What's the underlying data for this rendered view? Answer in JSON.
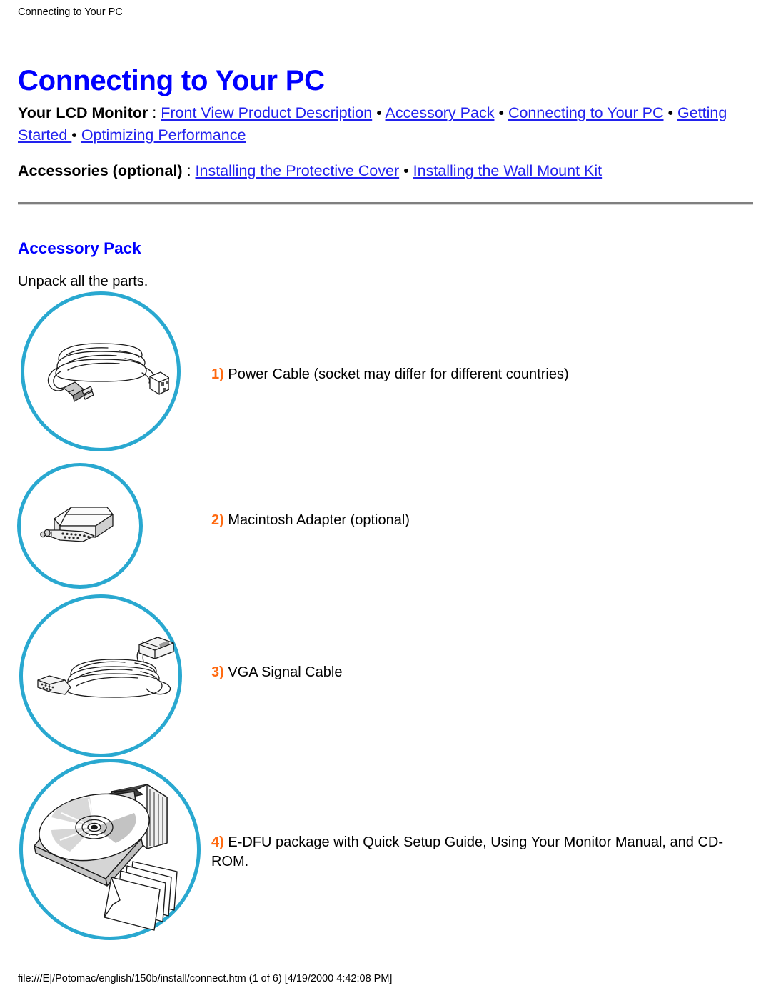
{
  "browser": {
    "header_title": "Connecting to Your PC",
    "footer": "file:///E|/Potomac/english/150b/install/connect.htm (1 of 6) [4/19/2000 4:42:08 PM]"
  },
  "page": {
    "title": "Connecting to Your PC"
  },
  "nav": {
    "monitor": {
      "label": "Your LCD Monitor",
      "colon": " : ",
      "links": [
        "Front View Product Description",
        "Accessory Pack",
        "Connecting to Your PC",
        "Getting Started ",
        "Optimizing Performance"
      ],
      "bullet": "•"
    },
    "accessories": {
      "label": "Accessories (optional)",
      "colon": " : ",
      "links": [
        "Installing the Protective Cover",
        "Installing the Wall Mount Kit"
      ],
      "bullet": "•"
    }
  },
  "section": {
    "heading": "Accessory Pack",
    "intro": "Unpack all the parts."
  },
  "accessories": [
    {
      "number": "1)",
      "text": " Power Cable (socket may differ for different countries)",
      "icon": "power-cable-illustration"
    },
    {
      "number": "2)",
      "text": " Macintosh Adapter (optional)",
      "icon": "macintosh-adapter-illustration"
    },
    {
      "number": "3)",
      "text": " VGA Signal Cable",
      "icon": "vga-signal-cable-illustration"
    },
    {
      "number": "4)",
      "text": " E-DFU package with Quick Setup Guide, Using Your Monitor Manual, and CD-ROM.",
      "icon": "cd-rom-documentation-illustration"
    }
  ],
  "colors": {
    "heading_blue": "#0000ff",
    "link_blue": "#2222ee",
    "circle_cyan": "#29a8d0",
    "number_orange": "#ff6a11",
    "divider_gray": "#7f7f7f"
  }
}
